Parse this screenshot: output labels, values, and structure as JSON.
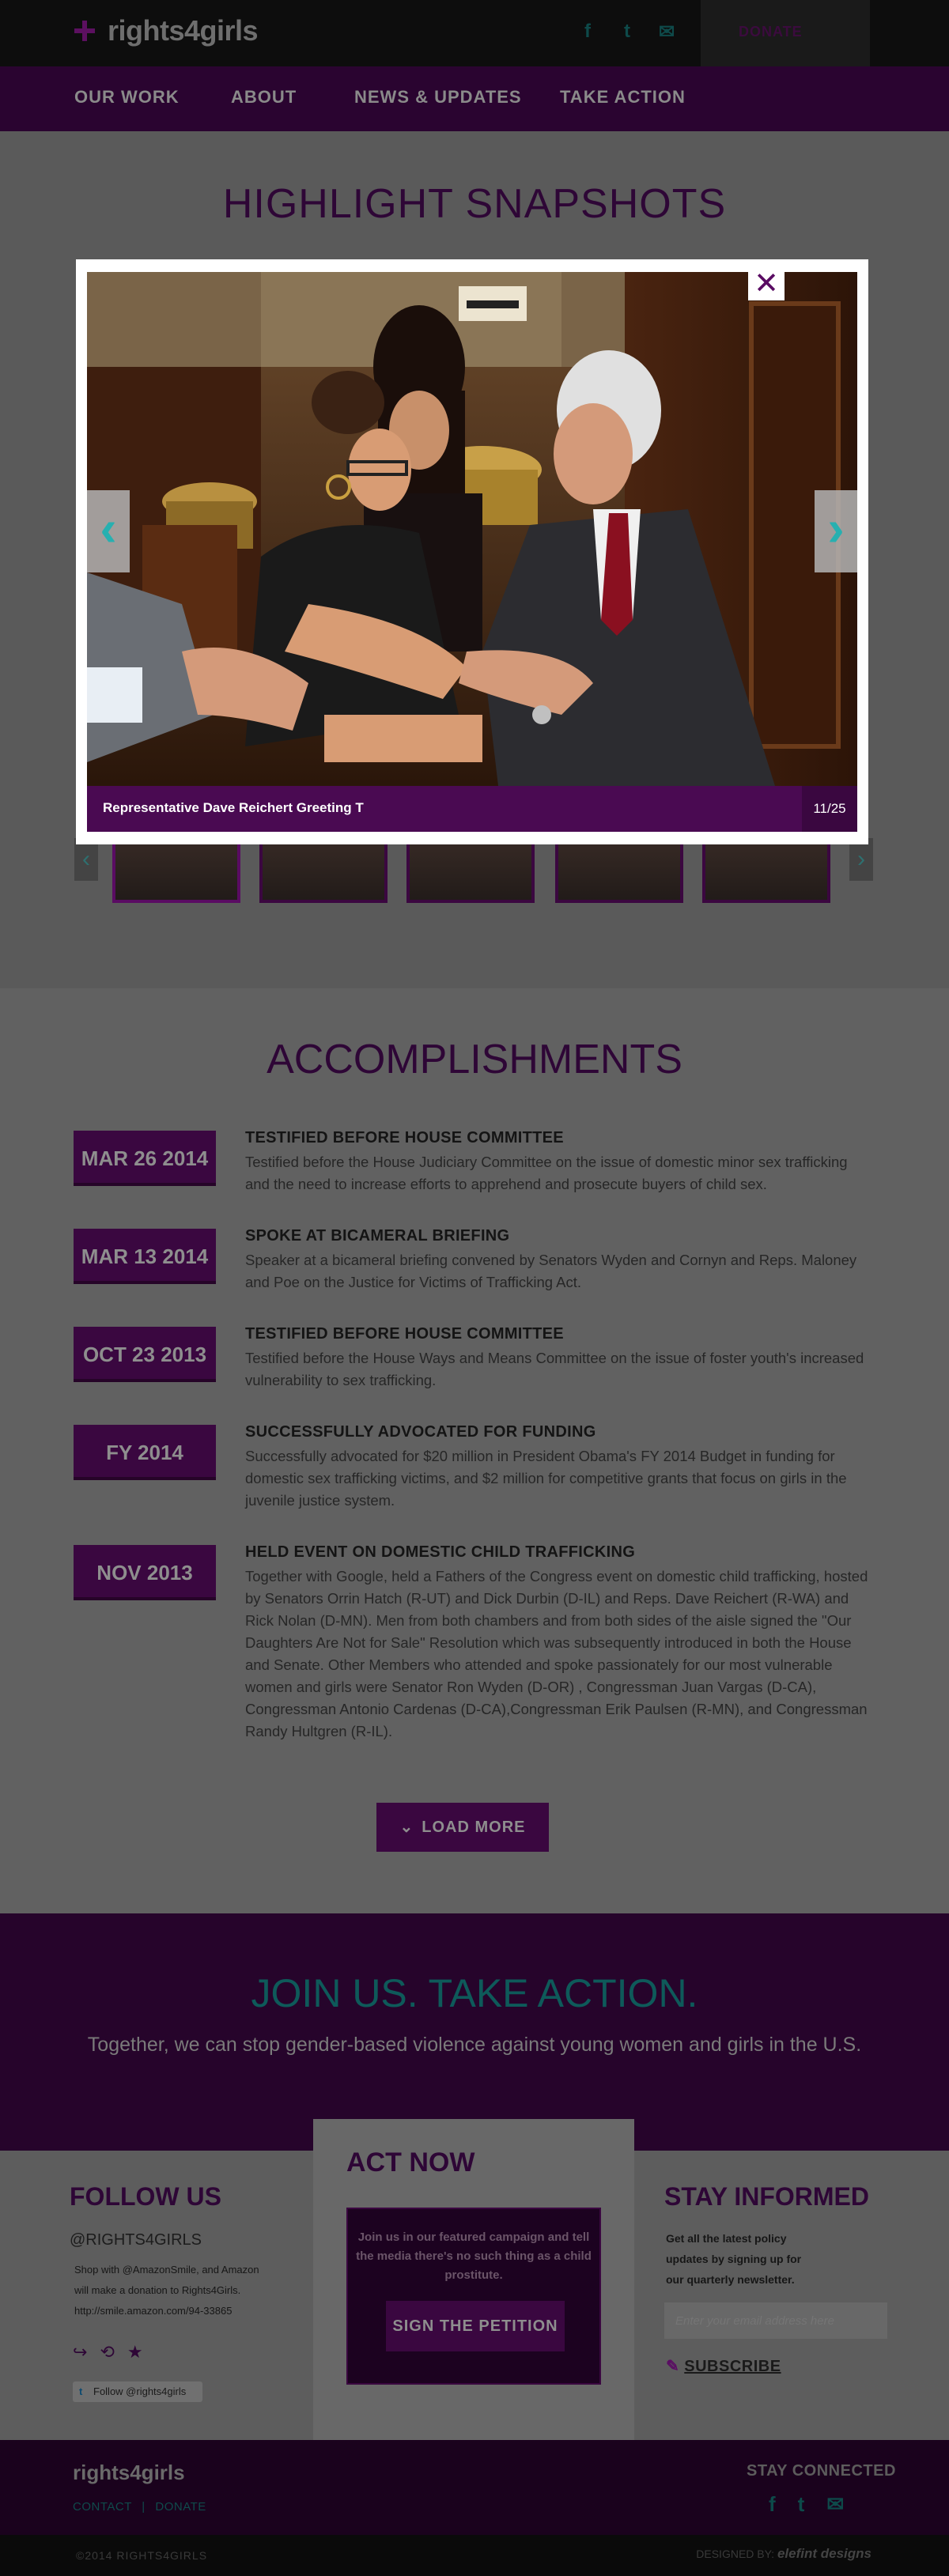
{
  "header": {
    "logo_text": "rights4girls",
    "social_icons": [
      "facebook-icon",
      "twitter-icon",
      "email-icon"
    ],
    "donate_label": "DONATE"
  },
  "nav": {
    "items": [
      {
        "label": "OUR WORK"
      },
      {
        "label": "ABOUT"
      },
      {
        "label": "NEWS & UPDATES"
      },
      {
        "label": "TAKE ACTION"
      }
    ]
  },
  "highlights": {
    "title": "HIGHLIGHT SNAPSHOTS",
    "caption": "Representative Dave Reichert Greeting T",
    "counter": "11/25",
    "thumb_count": 5
  },
  "accomplishments": {
    "title": "ACCOMPLISHMENTS",
    "items": [
      {
        "date": "MAR 26 2014",
        "heading": "TESTIFIED BEFORE HOUSE COMMITTEE",
        "body": "Testified before the House Judiciary Committee on the issue of domestic minor sex trafficking and the need to increase efforts to apprehend and prosecute buyers of child sex."
      },
      {
        "date": "MAR 13 2014",
        "heading": "SPOKE AT BICAMERAL BRIEFING",
        "body": "Speaker at a bicameral briefing convened by Senators Wyden and Cornyn and Reps. Maloney and Poe on the Justice for Victims of Trafficking Act."
      },
      {
        "date": "OCT 23 2013",
        "heading": "TESTIFIED BEFORE HOUSE COMMITTEE",
        "body": "Testified before the House Ways and Means Committee on the issue of foster youth's increased vulnerability to sex trafficking."
      },
      {
        "date": "FY 2014",
        "heading": "SUCCESSFULLY ADVOCATED FOR FUNDING",
        "body": "Successfully advocated for $20 million in President Obama's FY 2014 Budget in funding for domestic sex trafficking victims, and $2 million for competitive grants that focus on girls in the juvenile justice system."
      },
      {
        "date": "NOV 2013",
        "heading": "HELD EVENT ON DOMESTIC CHILD TRAFFICKING",
        "body": "Together with Google, held a Fathers of the Congress event on domestic child trafficking, hosted by Senators Orrin Hatch (R-UT) and Dick Durbin (D-IL) and Reps. Dave Reichert (R-WA) and Rick Nolan (D-MN). Men from both chambers and from both sides of the aisle signed the \"Our Daughters Are Not for Sale\" Resolution which was subsequently introduced in both the House and Senate.  Other Members who attended and spoke passionately for our most vulnerable women and girls were Senator Ron Wyden (D-OR) , Congressman Juan Vargas (D-CA), Congressman Antonio Cardenas (D-CA),Congressman Erik Paulsen (R-MN), and Congressman Randy Hultgren (R-IL)."
      }
    ],
    "load_more_label": "LOAD MORE"
  },
  "join": {
    "title": "JOIN US. TAKE ACTION.",
    "subtitle": "Together, we can stop gender-based violence against young women and girls in the U.S."
  },
  "follow": {
    "title": "FOLLOW US",
    "handle": "@RIGHTS4GIRLS",
    "tweet_lines": [
      "Shop with @AmazonSmile, and Amazon",
      "will make a donation to Rights4Girls.",
      "http://smile.amazon.com/94-33865"
    ],
    "follow_button": "Follow @rights4girls"
  },
  "act_now": {
    "title": "ACT NOW",
    "text": "Join us in our featured campaign and tell the media there's no such thing as a child prostitute.",
    "button": "SIGN THE PETITION"
  },
  "stay_informed": {
    "title": "STAY INFORMED",
    "text_lines": [
      "Get all the latest policy",
      "updates by signing up for",
      "our quarterly newsletter."
    ],
    "email_placeholder": "Enter your email address here",
    "subscribe_label": "SUBSCRIBE"
  },
  "footer": {
    "logo_text": "rights4girls",
    "contact_label": "CONTACT",
    "separator": "|",
    "donate_label": "DONATE",
    "stay_connected": "STAY CONNECTED",
    "copyright": "©2014 RIGHTS4GIRLS",
    "designed_by": "DESIGNED BY:",
    "designer": "elefint designs"
  }
}
